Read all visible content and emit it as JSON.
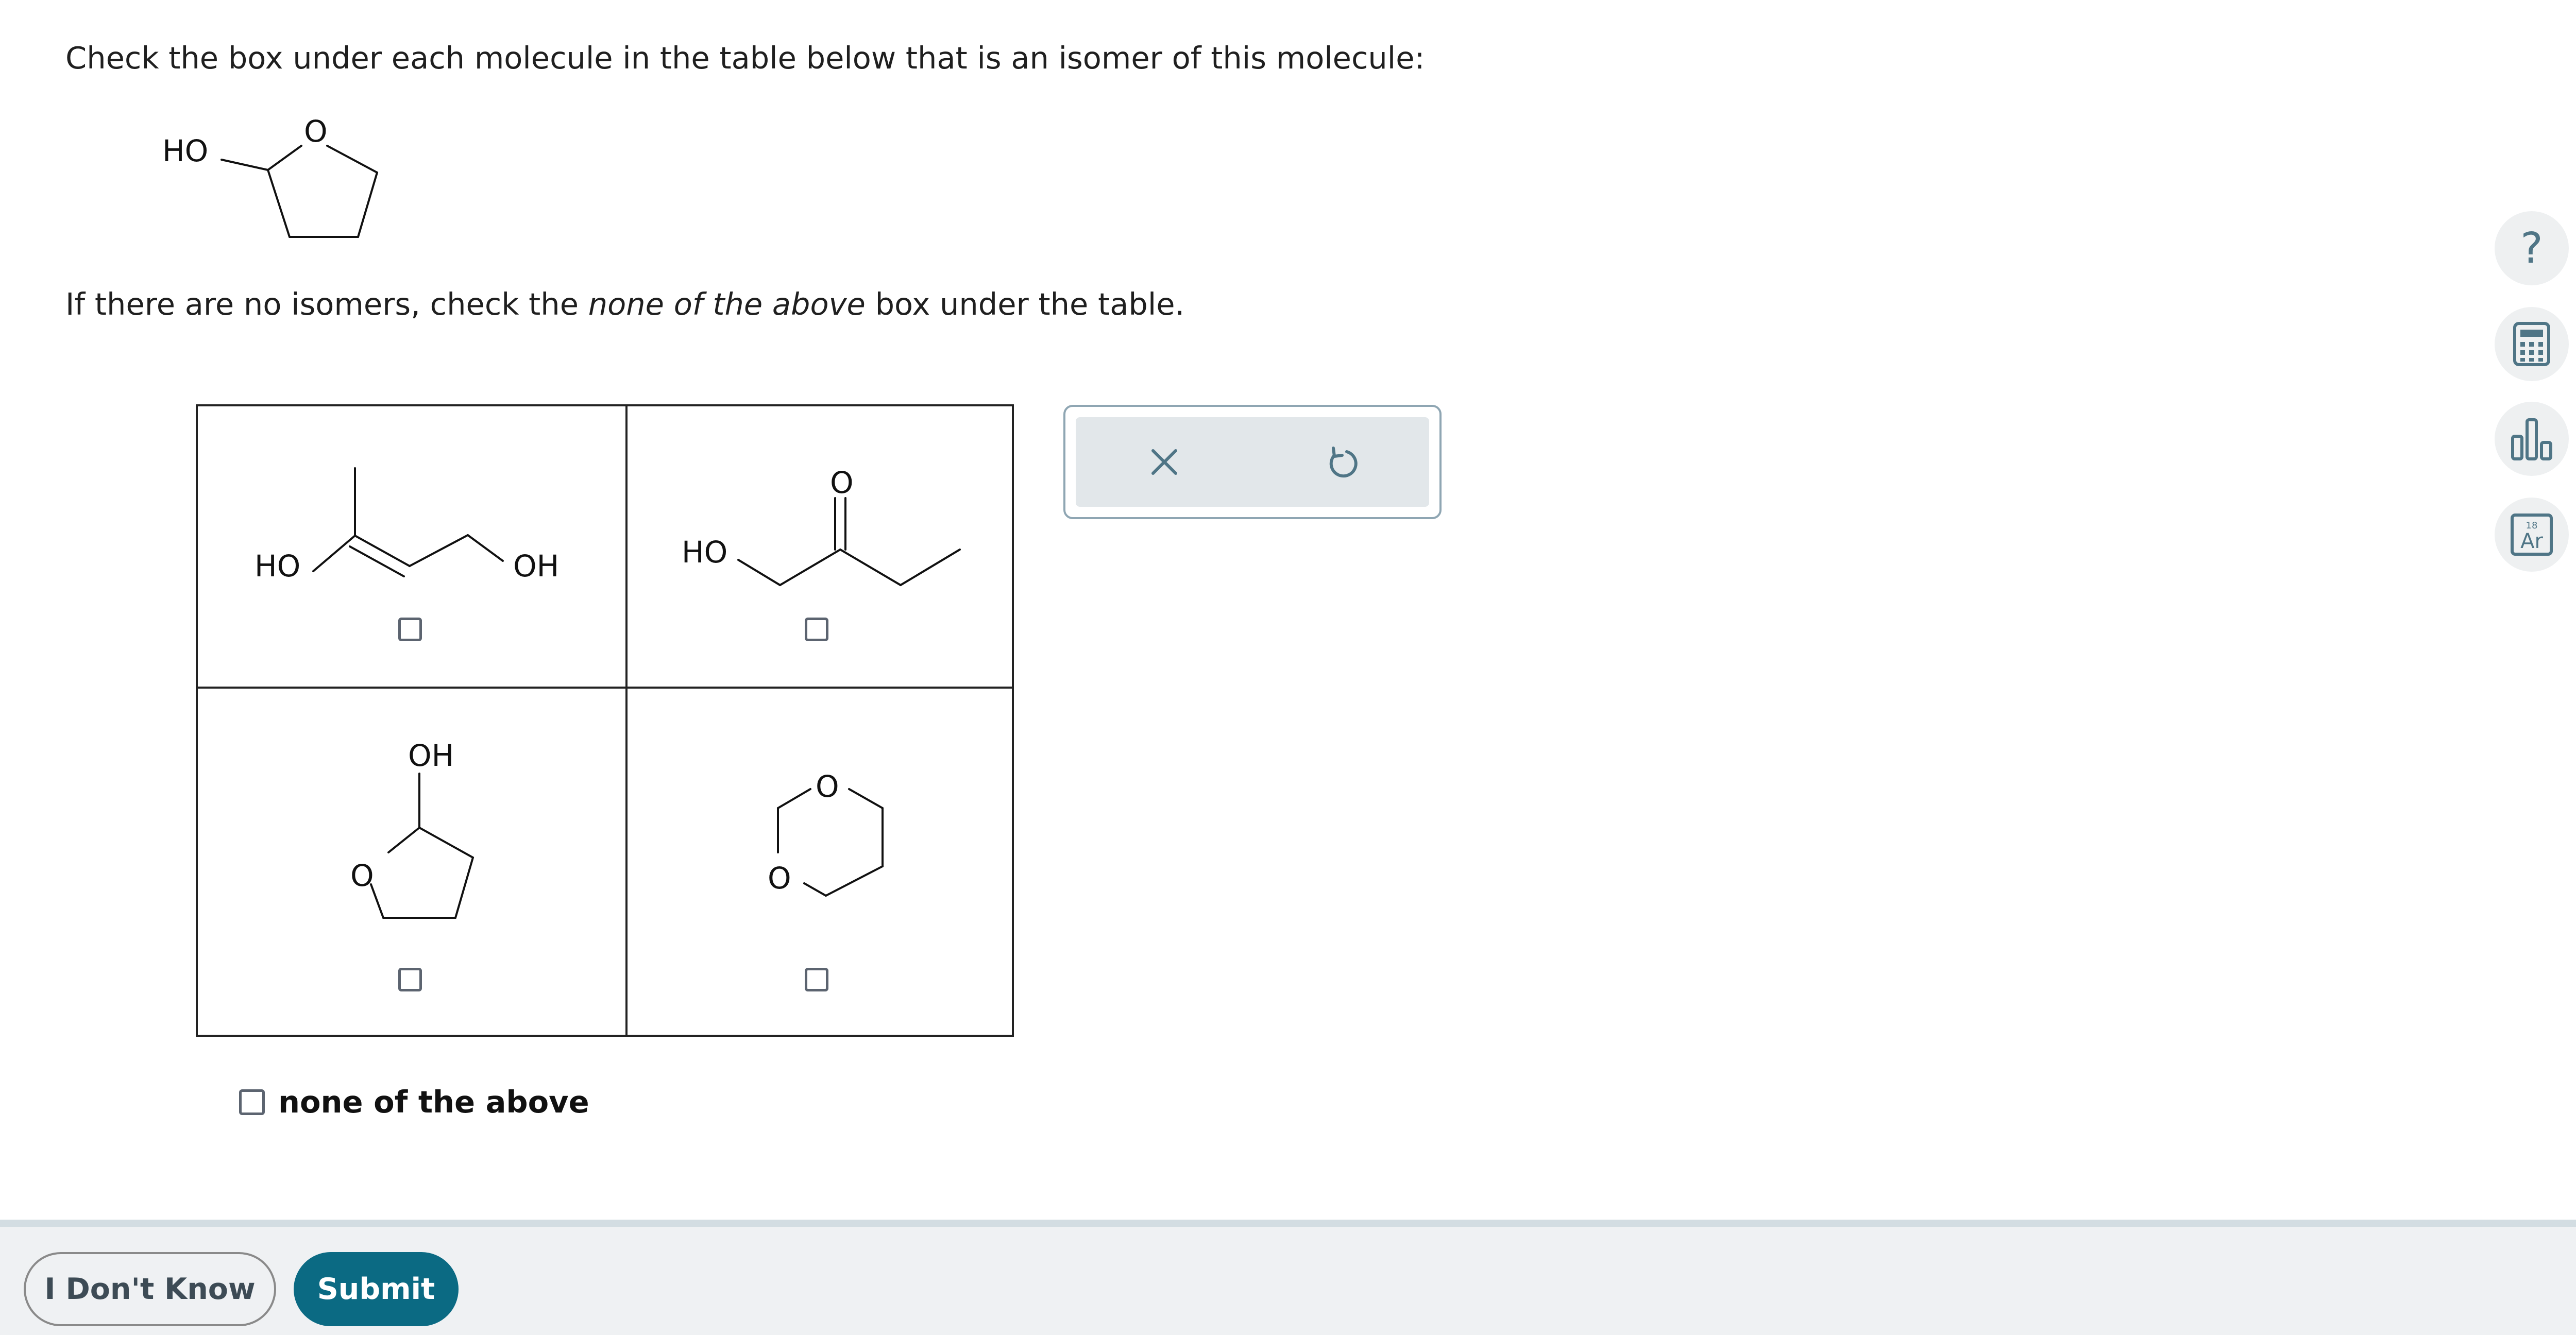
{
  "question": {
    "prompt": "Check the box under each molecule in the table below that is an isomer of this molecule:",
    "instruction_prefix": "If there are no isomers, check the ",
    "instruction_emph": "none of the above",
    "instruction_suffix": " box under the table."
  },
  "reference_molecule": {
    "ho_label": "HO",
    "o_label": "O"
  },
  "table": {
    "cells": [
      {
        "labels": [
          "HO",
          "OH"
        ],
        "checked": false
      },
      {
        "labels": [
          "HO",
          "O"
        ],
        "checked": false
      },
      {
        "labels": [
          "OH",
          "O"
        ],
        "checked": false
      },
      {
        "labels": [
          "O",
          "O"
        ],
        "checked": false
      }
    ]
  },
  "none_option": {
    "label": "none of the above",
    "checked": false
  },
  "tools": {
    "clear_icon": "close-icon",
    "undo_icon": "undo-icon"
  },
  "sidebar": {
    "help_glyph": "?",
    "periodic_number": "18",
    "periodic_symbol": "Ar"
  },
  "footer": {
    "dont_know_label": "I Don't Know",
    "submit_label": "Submit"
  },
  "colors": {
    "accent": "#0b6a83",
    "icon": "#4f7586",
    "footer_bg": "#eff1f3"
  }
}
